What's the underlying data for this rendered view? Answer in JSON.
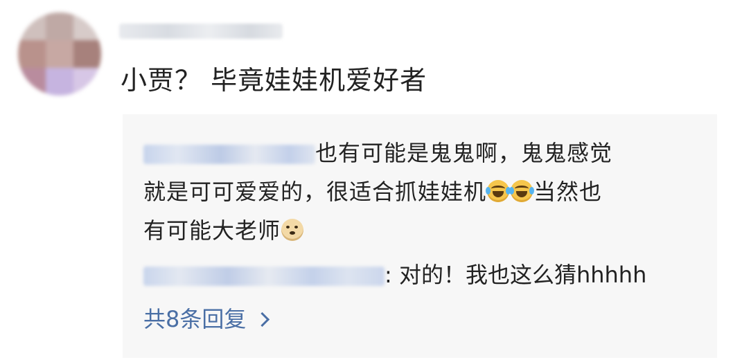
{
  "comment": {
    "text": "小贾？ 毕竟娃娃机爱好者"
  },
  "replies": [
    {
      "text_part1": "也有可能是鬼鬼啊，鬼鬼感觉",
      "text_part2": "就是可可爱爱的，很适合抓娃娃机",
      "text_part3": "当然也",
      "text_part4": "有可能大老师",
      "emoji_1": "laugh-crying-emoji",
      "emoji_2": "laugh-crying-emoji",
      "emoji_3": "doge-emoji"
    },
    {
      "text": ": 对的！我也这么猜hhhhh"
    }
  ],
  "more_replies": {
    "label": "共8条回复",
    "icon": "chevron-right-icon"
  },
  "colors": {
    "link": "#4a6fa5",
    "reply_bg": "#f7f7f7",
    "text": "#222222"
  }
}
